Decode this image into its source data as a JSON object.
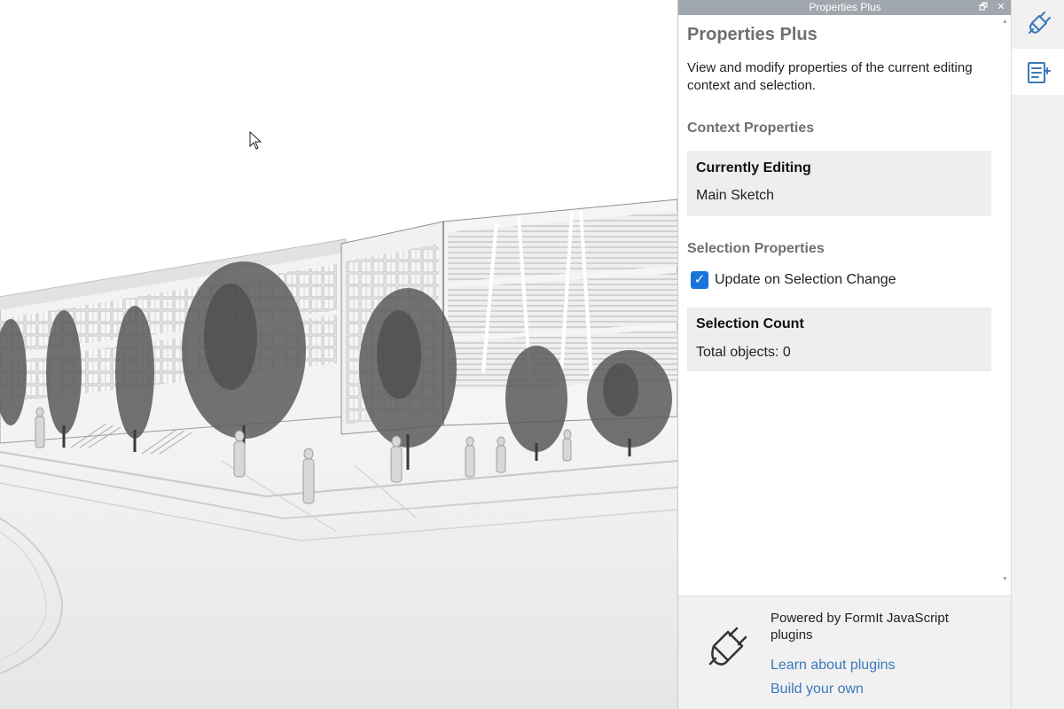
{
  "panel": {
    "window_title": "Properties Plus",
    "restore_glyph": "🗗",
    "close_glyph": "✕",
    "title": "Properties Plus",
    "description": "View and modify properties of the current editing context and selection.",
    "context": {
      "heading": "Context Properties",
      "currently_editing_label": "Currently Editing",
      "currently_editing_value": "Main Sketch"
    },
    "selection": {
      "heading": "Selection Properties",
      "update_on_change_label": "Update on Selection Change",
      "update_on_change_checked": true,
      "checkmark": "✓",
      "count_label": "Selection Count",
      "count_value": "Total objects: 0"
    },
    "footer": {
      "powered_by": "Powered by FormIt JavaScript plugins",
      "learn_link": "Learn about plugins",
      "build_link": "Build your own"
    }
  },
  "toolbar": {
    "buttons": [
      {
        "icon": "plugin-manager-icon",
        "active": false
      },
      {
        "icon": "properties-plus-icon",
        "active": true
      }
    ]
  },
  "colors": {
    "titlebar": "#a1a7ae",
    "accent_checkbox": "#1a73d9",
    "link": "#3b78b8",
    "toolbar_icon": "#3b78b8"
  }
}
